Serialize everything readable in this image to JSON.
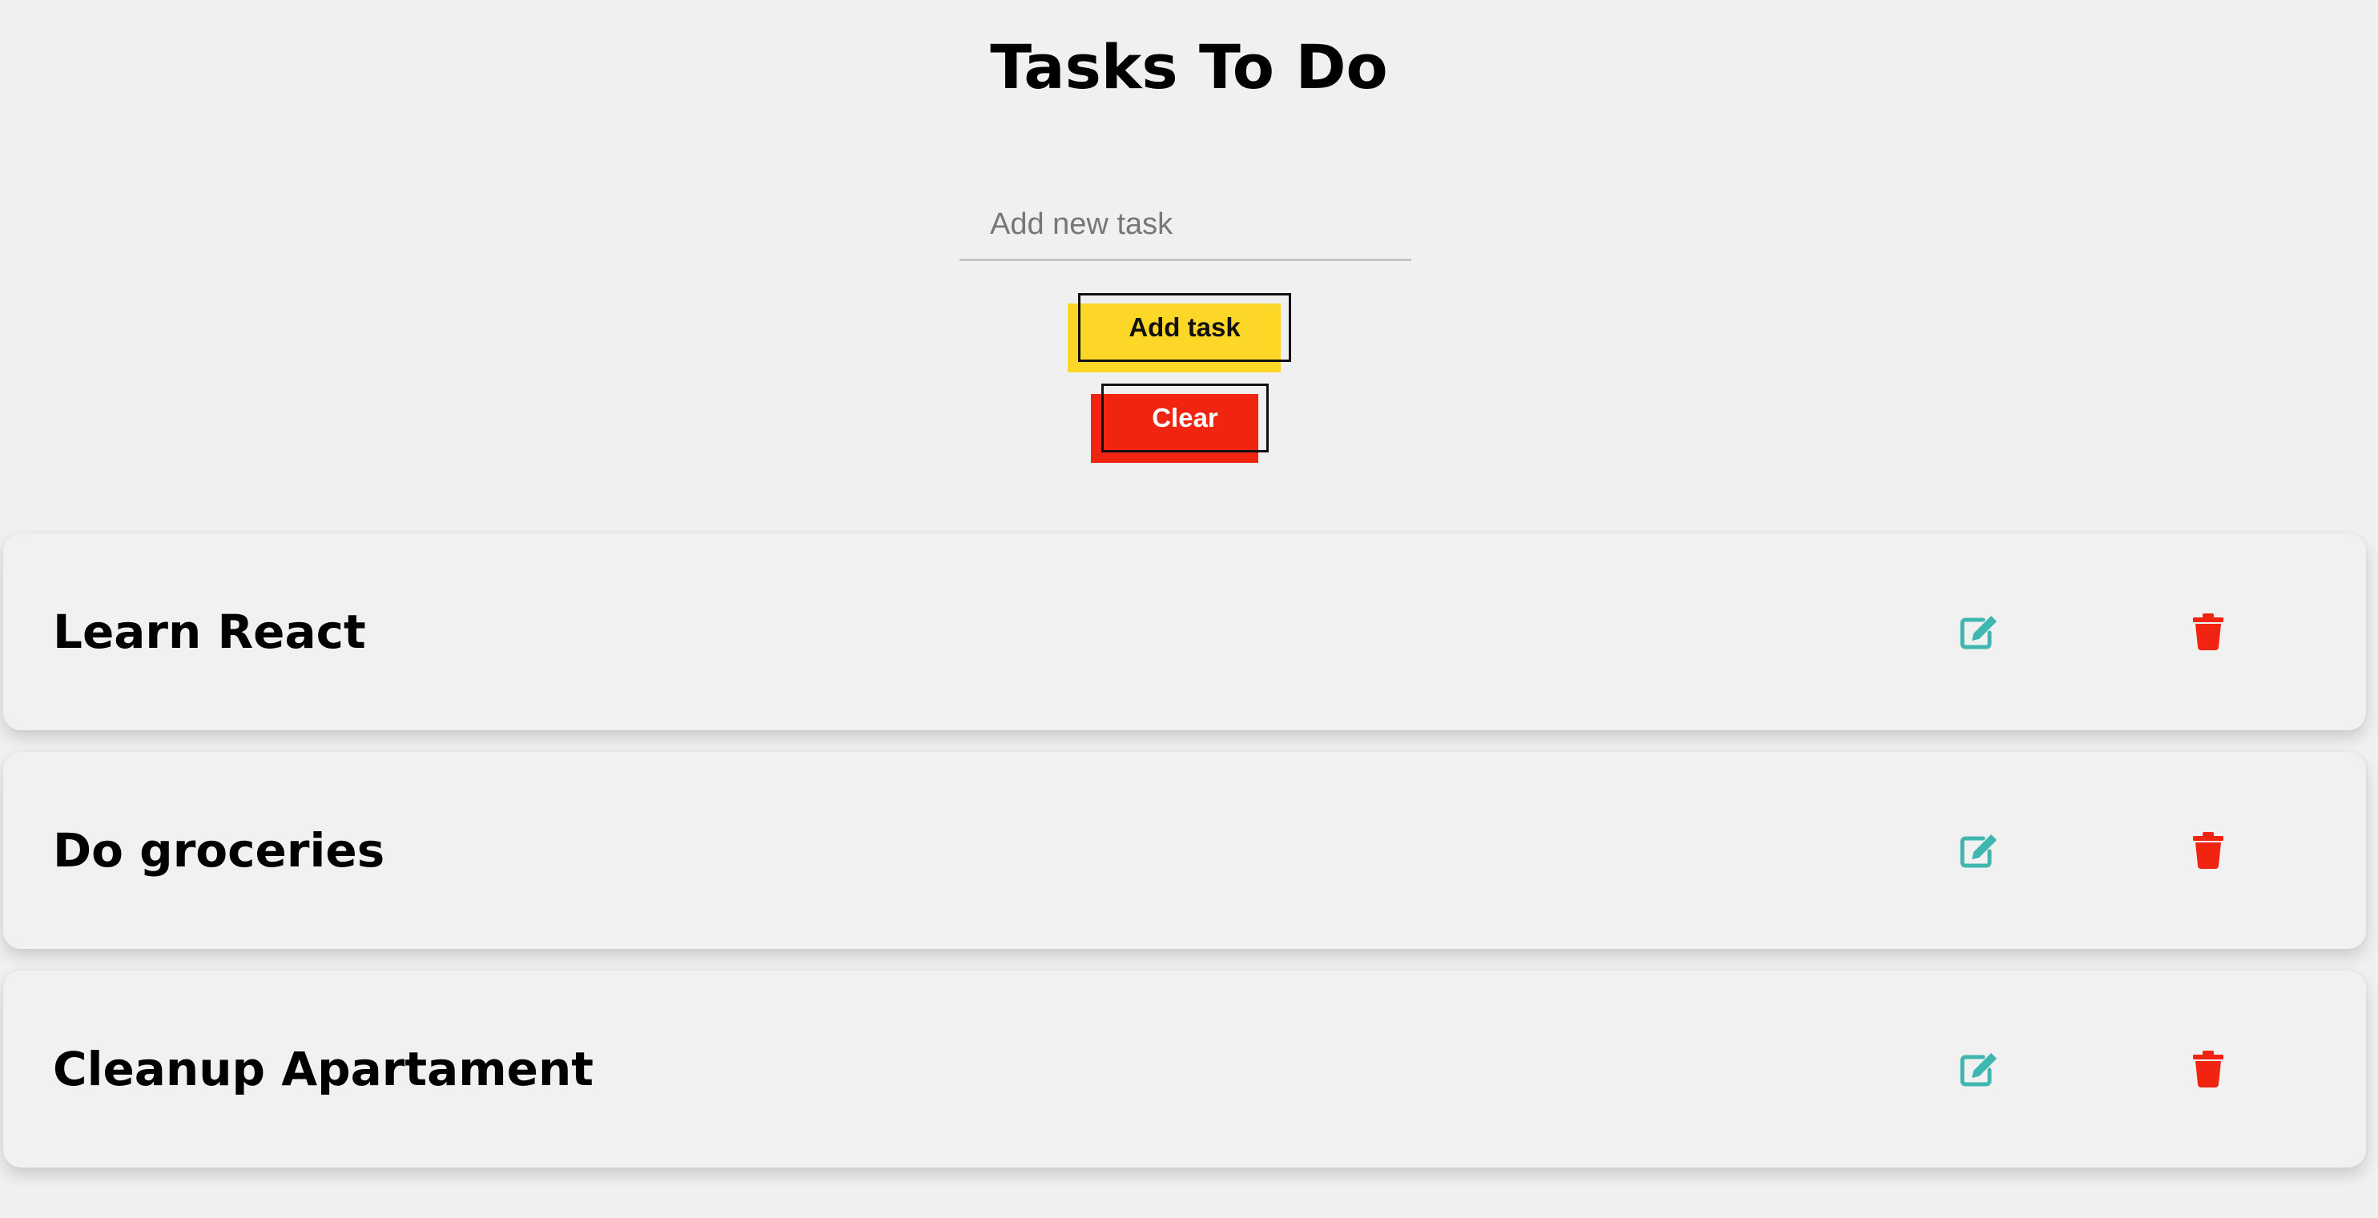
{
  "header": {
    "title": "Tasks To Do"
  },
  "form": {
    "task_input_value": "",
    "task_input_placeholder": "Add new task",
    "add_button_label": "Add task",
    "clear_button_label": "Clear"
  },
  "tasks": [
    {
      "name": "Learn React",
      "edit_icon": "edit-icon",
      "delete_icon": "trash-icon"
    },
    {
      "name": "Do groceries",
      "edit_icon": "edit-icon",
      "delete_icon": "trash-icon"
    },
    {
      "name": "Cleanup Apartament",
      "edit_icon": "edit-icon",
      "delete_icon": "trash-icon"
    }
  ],
  "colors": {
    "add_button": "#fdd728",
    "clear_button": "#f12412",
    "edit_icon": "#3fb7b0",
    "delete_icon": "#f12412",
    "background": "#f0f0f0"
  }
}
